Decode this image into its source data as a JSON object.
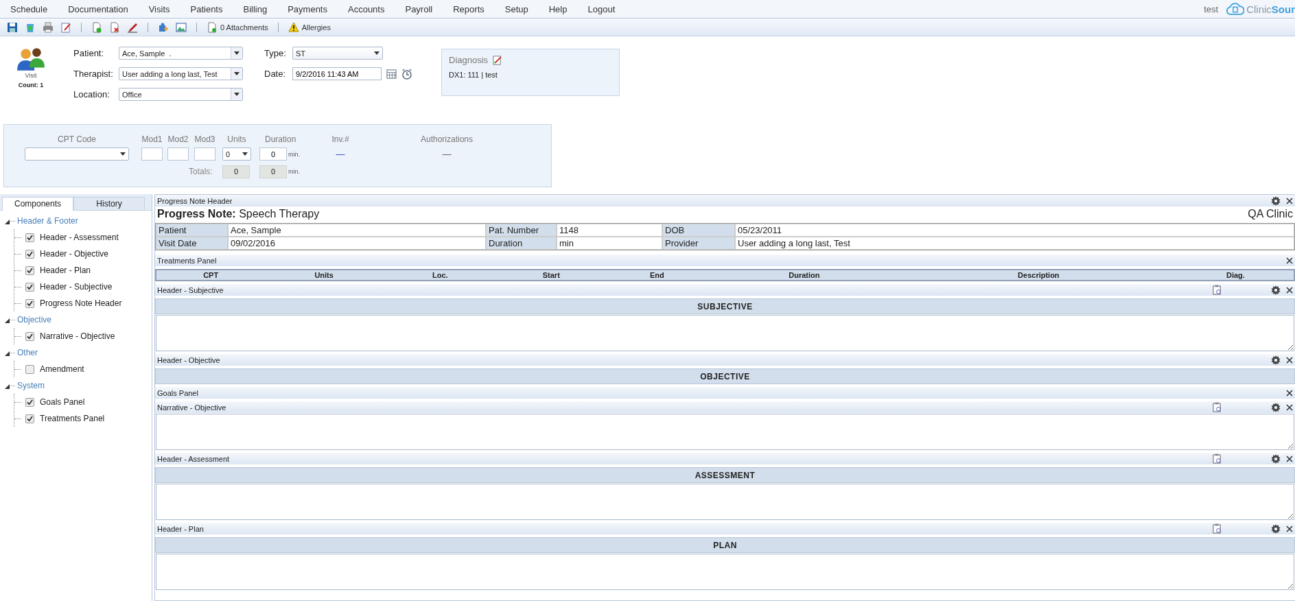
{
  "menu": [
    {
      "label": "Schedule"
    },
    {
      "label": "Documentation"
    },
    {
      "label": "Visits"
    },
    {
      "label": "Patients"
    },
    {
      "label": "Billing"
    },
    {
      "label": "Payments"
    },
    {
      "label": "Accounts"
    },
    {
      "label": "Payroll"
    },
    {
      "label": "Reports"
    },
    {
      "label": "Setup"
    },
    {
      "label": "Help"
    },
    {
      "label": "Logout"
    }
  ],
  "user": "test",
  "logo": "Clinic**Sour**",
  "toolbar": {
    "attachments": "0 Attachments",
    "allergies": "Allergies"
  },
  "visit": {
    "icon_label": "Visit",
    "count": "Count: 1",
    "fields": [
      {
        "label": "Patient:",
        "value": "Ace, Sample  ."
      },
      {
        "label": "Therapist:",
        "value": "User adding a long last, Test"
      },
      {
        "label": "Location:",
        "value": "Office"
      }
    ],
    "type": {
      "label": "Type:",
      "value": "ST"
    },
    "date": {
      "label": "Date:",
      "value": "9/2/2016 11:43 AM"
    },
    "diagnosis": {
      "title": "Diagnosis",
      "line": "DX1: 111 | test"
    }
  },
  "cpt": {
    "columns": [
      "CPT Code",
      "Mod1",
      "Mod2",
      "Mod3",
      "Units",
      "Duration",
      "Inv.#",
      "Authorizations"
    ],
    "units": "0",
    "duration": "0",
    "unit_label": "min.",
    "inv": "—",
    "auth": "—",
    "totals_label": "Totals:",
    "total_units": "0",
    "total_duration": "0",
    "total_unit_label": "min."
  },
  "tabs": [
    {
      "label": "Components",
      "selected": true
    },
    {
      "label": "History",
      "selected": false
    }
  ],
  "tree": [
    {
      "label": "Header & Footer",
      "expanded": true,
      "children": [
        {
          "label": "Header - Assessment",
          "checked": true
        },
        {
          "label": "Header - Objective",
          "checked": true
        },
        {
          "label": "Header - Plan",
          "checked": true
        },
        {
          "label": "Header - Subjective",
          "checked": true
        },
        {
          "label": "Progress Note Header",
          "checked": true
        }
      ]
    },
    {
      "label": "Objective",
      "expanded": true,
      "children": [
        {
          "label": "Narrative - Objective",
          "checked": true
        }
      ]
    },
    {
      "label": "Other",
      "expanded": true,
      "children": [
        {
          "label": "Amendment",
          "checked": false
        }
      ]
    },
    {
      "label": "System",
      "expanded": true,
      "children": [
        {
          "label": "Goals Panel",
          "checked": true
        },
        {
          "label": "Treatments Panel",
          "checked": true
        }
      ]
    }
  ],
  "panels": [
    {
      "kind": "note_header",
      "title": "Progress Note Header",
      "template": false,
      "settings": true,
      "heading": "**Progress Note:**  Speech Therapy",
      "clinic": "QA Clinic",
      "rows": [
        [
          "Patient",
          "Ace, Sample",
          "Pat. Number",
          "1148",
          "DOB",
          "05/23/2011"
        ],
        [
          "Visit Date",
          "09/02/2016",
          "Duration",
          " min",
          "Provider",
          "User adding a long last, Test"
        ]
      ]
    },
    {
      "kind": "table",
      "title": "Treatments Panel",
      "template": false,
      "settings": false,
      "columns": [
        "CPT",
        "Units",
        "Loc.",
        "Start",
        "End",
        "Duration",
        "Description",
        "Diag."
      ]
    },
    {
      "kind": "section",
      "title": "Header - Subjective",
      "template": true,
      "settings": true,
      "heading": "SUBJECTIVE",
      "editor": true
    },
    {
      "kind": "section",
      "title": "Header - Objective",
      "template": false,
      "settings": true,
      "heading": "OBJECTIVE",
      "editor": false
    },
    {
      "kind": "empty",
      "title": "Goals Panel",
      "template": false,
      "settings": false
    },
    {
      "kind": "editor",
      "title": "Narrative - Objective",
      "template": true,
      "settings": true
    },
    {
      "kind": "section",
      "title": "Header - Assessment",
      "template": true,
      "settings": true,
      "heading": "ASSESSMENT",
      "editor": true
    },
    {
      "kind": "section",
      "title": "Header - Plan",
      "template": true,
      "settings": true,
      "heading": "PLAN",
      "editor": true
    }
  ]
}
